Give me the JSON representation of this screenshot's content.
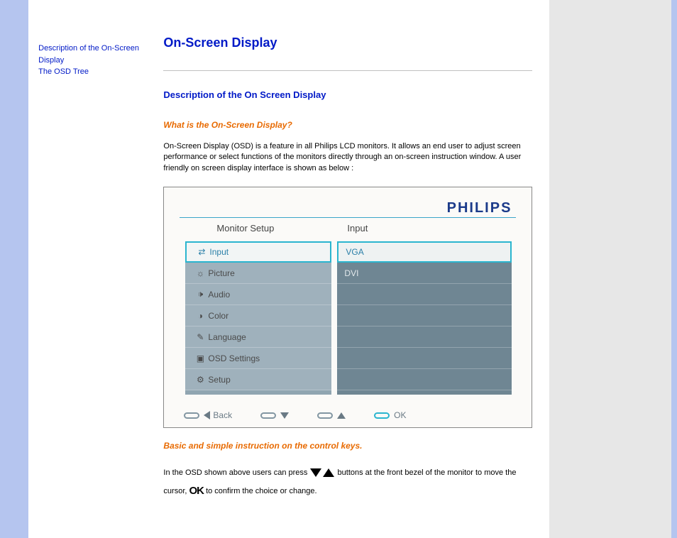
{
  "sidebar": {
    "links": [
      "Description of the On-Screen Display",
      "The OSD Tree"
    ]
  },
  "page": {
    "title": "On-Screen Display",
    "section_title": "Description of the On Screen Display",
    "question": "What is the On-Screen Display?",
    "intro": "On-Screen Display (OSD) is a feature in all Philips LCD monitors. It allows an end user to adjust screen performance or select functions of the monitors directly through an on-screen instruction window. A user friendly on screen display interface is shown as below :",
    "instr_title": "Basic and simple instruction on the control keys.",
    "instr_pre": "In the OSD shown above users can press",
    "instr_mid": "buttons at the front bezel of the monitor to move the cursor,",
    "ok_label": "OK",
    "instr_post": " to confirm the choice or change."
  },
  "osd": {
    "brand": "PHILIPS",
    "col_left_title": "Monitor Setup",
    "col_right_title": "Input",
    "menu": [
      {
        "icon": "input-icon",
        "glyph": "⇄",
        "label": "Input",
        "selected": true
      },
      {
        "icon": "picture-icon",
        "glyph": "☼",
        "label": "Picture",
        "selected": false
      },
      {
        "icon": "audio-icon",
        "glyph": "🕩",
        "label": "Audio",
        "selected": false
      },
      {
        "icon": "color-icon",
        "glyph": "◑",
        "label": "Color",
        "selected": false
      },
      {
        "icon": "language-icon",
        "glyph": "✎",
        "label": "Language",
        "selected": false
      },
      {
        "icon": "osd-settings-icon",
        "glyph": "▣",
        "label": "OSD Settings",
        "selected": false
      },
      {
        "icon": "setup-icon",
        "glyph": "⚙",
        "label": "Setup",
        "selected": false
      }
    ],
    "options": [
      {
        "label": "VGA",
        "selected": true
      },
      {
        "label": "DVI",
        "selected": false
      }
    ],
    "footer": {
      "back": "Back",
      "ok": "OK"
    }
  }
}
